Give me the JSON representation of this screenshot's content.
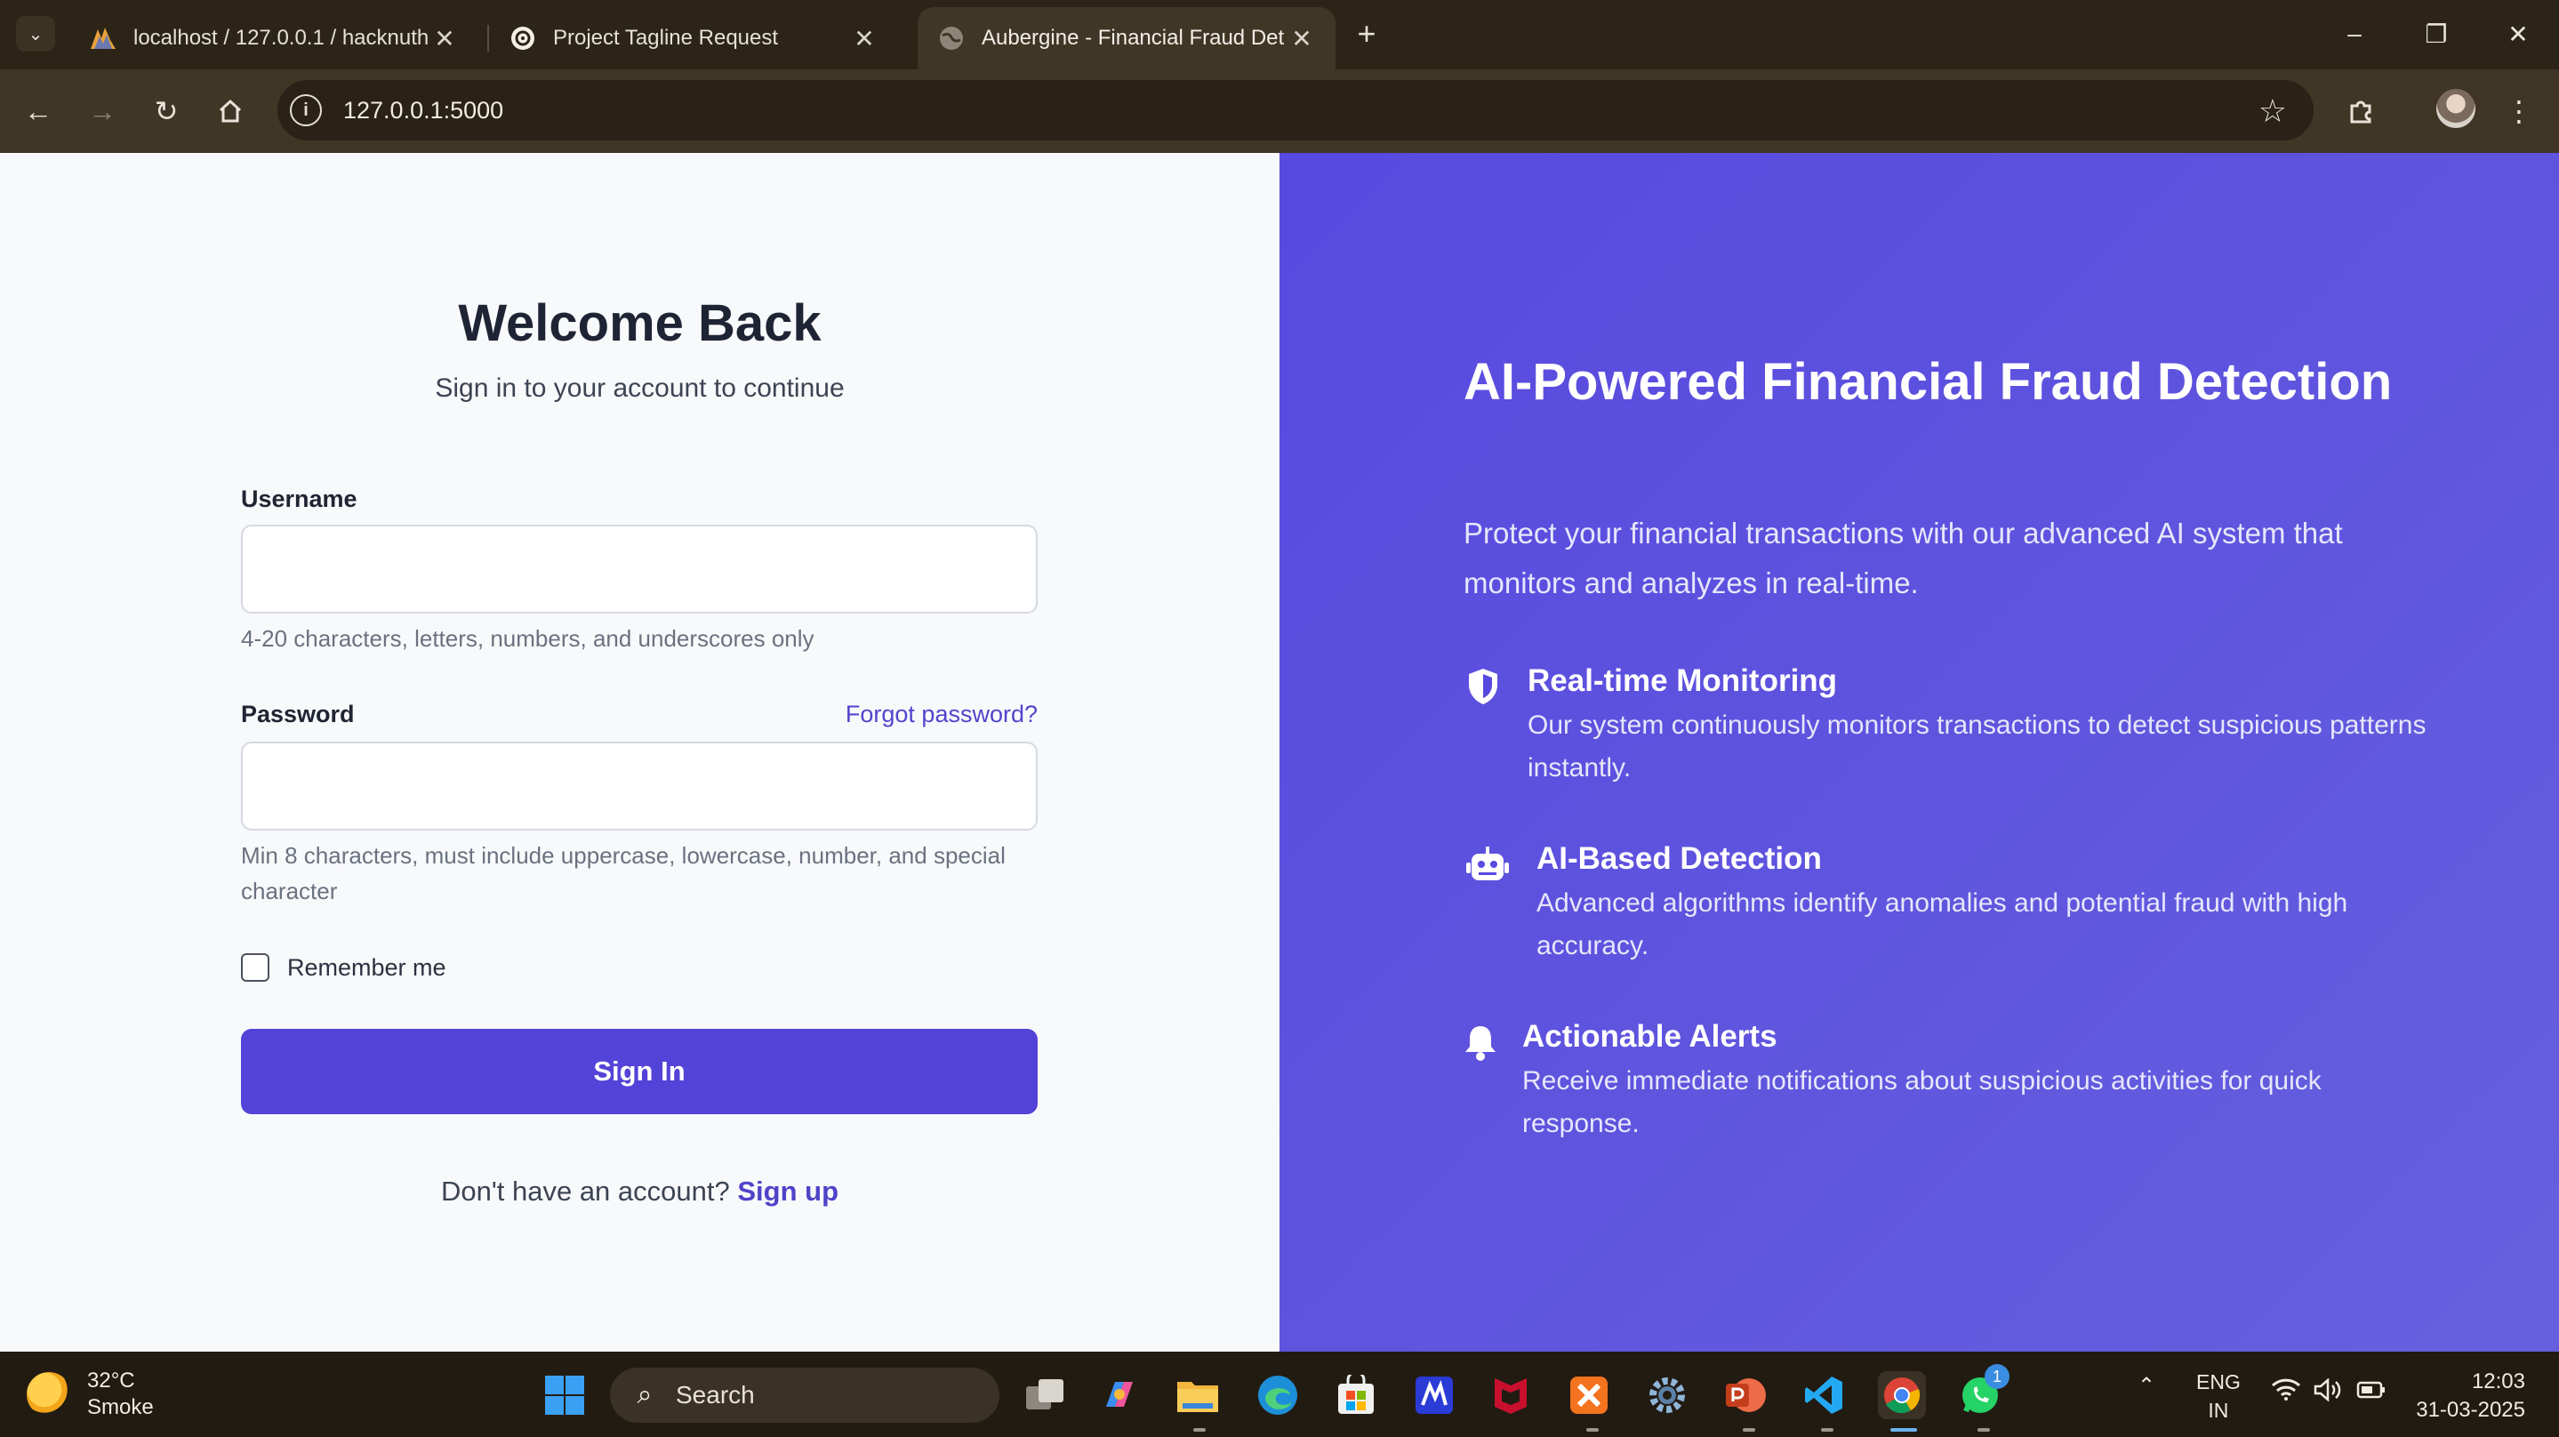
{
  "browser": {
    "tabs": [
      {
        "title": "localhost / 127.0.0.1 / hacknuth",
        "active": false
      },
      {
        "title": "Project Tagline Request",
        "active": false
      },
      {
        "title": "Aubergine - Financial Fraud Det",
        "active": true
      }
    ],
    "url": "127.0.0.1:5000"
  },
  "login": {
    "title": "Welcome Back",
    "subtitle": "Sign in to your account to continue",
    "username_label": "Username",
    "username_value": "",
    "username_hint": "4-20 characters, letters, numbers, and underscores only",
    "password_label": "Password",
    "password_value": "",
    "forgot_link": "Forgot password?",
    "password_hint": "Min 8 characters, must include uppercase, lowercase, number, and special character",
    "remember_label": "Remember me",
    "remember_checked": false,
    "submit_label": "Sign In",
    "signup_prompt": "Don't have an account?",
    "signup_link": "Sign up"
  },
  "hero": {
    "title": "AI-Powered Financial Fraud Detection",
    "description": "Protect your financial transactions with our advanced AI system that monitors and analyzes in real-time.",
    "features": [
      {
        "icon": "shield-icon",
        "title": "Real-time Monitoring",
        "description": "Our system continuously monitors transactions to detect suspicious patterns instantly."
      },
      {
        "icon": "robot-icon",
        "title": "AI-Based Detection",
        "description": "Advanced algorithms identify anomalies and potential fraud with high accuracy."
      },
      {
        "icon": "bell-icon",
        "title": "Actionable Alerts",
        "description": "Receive immediate notifications about suspicious activities for quick response."
      }
    ]
  },
  "taskbar": {
    "weather_temp": "32°C",
    "weather_desc": "Smoke",
    "search_label": "Search",
    "lang_primary": "ENG",
    "lang_secondary": "IN",
    "time": "12:03",
    "date": "31-03-2025",
    "whatsapp_badge": "1"
  },
  "colors": {
    "primary": "#5443d8",
    "hero_gradient_start": "#5849e0",
    "hero_gradient_end": "#6561de",
    "link": "#5145cd"
  }
}
